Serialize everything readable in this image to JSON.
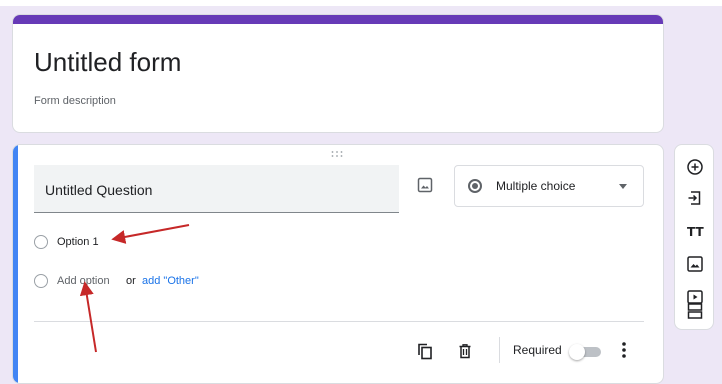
{
  "form": {
    "title": "Untitled form",
    "description": "Form description",
    "accent_color": "#673ab7"
  },
  "question": {
    "title": "Untitled Question",
    "type_label": "Multiple choice",
    "accent_color": "#4285f4",
    "options": [
      {
        "label": "Option 1"
      }
    ],
    "add_option_label": "Add option",
    "or_label": "or",
    "add_other_label": "add \"Other\"",
    "required_label": "Required",
    "required": false
  },
  "toolbar": {
    "items": [
      {
        "icon": "add-circle-icon"
      },
      {
        "icon": "import-icon"
      },
      {
        "icon": "title-text-icon"
      },
      {
        "icon": "image-icon"
      },
      {
        "icon": "video-icon"
      },
      {
        "icon": "section-icon"
      }
    ],
    "tt_glyph": "TT"
  },
  "annotations": {
    "arrow_color": "#c62828"
  }
}
